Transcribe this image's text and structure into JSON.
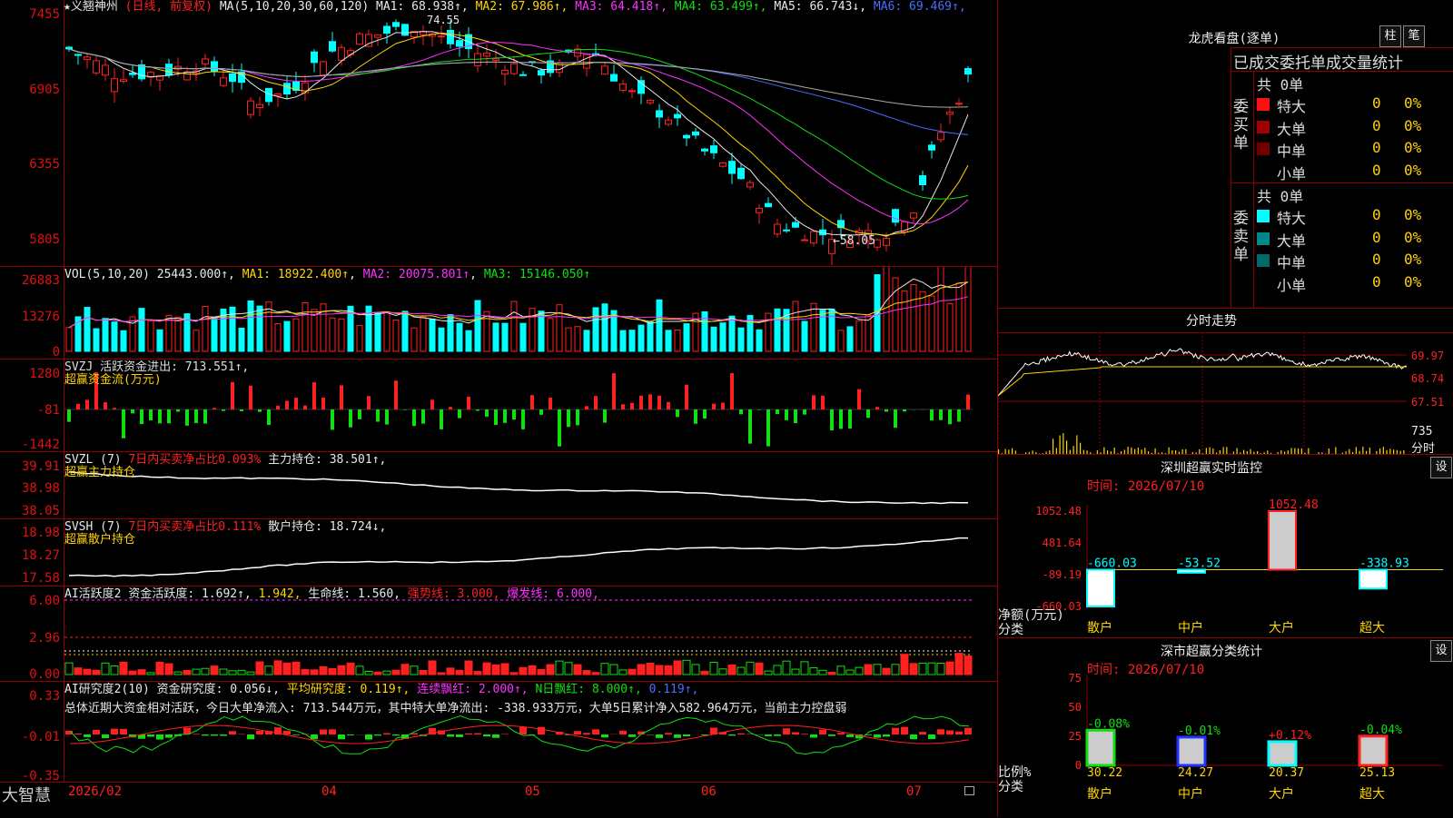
{
  "kline": {
    "stock_name": "义翘神州",
    "period_label": "(日线, 前复权)",
    "ma_params": "MA(5,10,20,30,60,120)",
    "ma_values": [
      {
        "label": "MA1: 68.938↑",
        "color": "#e8e8e8"
      },
      {
        "label": "MA2: 67.986↑",
        "color": "#ffd400"
      },
      {
        "label": "MA3: 64.418↑",
        "color": "#ff30ff"
      },
      {
        "label": "MA4: 63.499↑",
        "color": "#10e010"
      },
      {
        "label": "MA5: 66.743↓",
        "color": "#e8e8e8"
      },
      {
        "label": "MA6: 69.469↑",
        "color": "#4a6cff"
      }
    ],
    "high_mark": "74.55",
    "low_mark": "←58.05",
    "y_labels": [
      "7455",
      "6905",
      "6355",
      "5805"
    ]
  },
  "vol": {
    "header_name": "VOL(5,10,20)",
    "header_value": "25443.000↑",
    "ma1": "MA1: 18922.400↑",
    "ma2": "MA2: 20075.801↑",
    "ma3": "MA3: 15146.050↑",
    "y_labels": [
      "26883",
      "13276",
      "0"
    ]
  },
  "svzj": {
    "header": "SVZJ  活跃资金进出: 713.551↑,",
    "subtitle": "超赢资金流(万元)",
    "y_labels": [
      "1280",
      "-81",
      "-1442"
    ]
  },
  "svzl": {
    "header_name": "SVZL (7)",
    "header_ratio": "7日内买卖净占比0.093%",
    "header_hold": "主力持仓: 38.501↑,",
    "subtitle": "超赢主力持仓",
    "y_labels": [
      "39.91",
      "38.98",
      "38.05"
    ]
  },
  "svsh": {
    "header_name": "SVSH (7)",
    "header_ratio": "7日内买卖净占比0.111%",
    "header_hold": "散户持仓: 18.724↓,",
    "subtitle": "超赢散户持仓",
    "y_labels": [
      "18.98",
      "18.27",
      "17.58"
    ]
  },
  "ai_active": {
    "h1": "AI活跃度2",
    "h2": "资金活跃度: 1.692↑,",
    "h3": "1.942,",
    "h4": "生命线: 1.560,",
    "h5": "强势线: 3.000,",
    "h6": "爆发线: 6.000,",
    "y_labels": [
      "6.00",
      "2.96",
      "0.00"
    ]
  },
  "ai_research": {
    "h1": "AI研究度2(10)",
    "h2": "资金研究度: 0.056↓,",
    "h3": "平均研究度: 0.119↑,",
    "h4": "连续飘红: 2.000↑,",
    "h5": "N日飘红: 8.000↑,",
    "h6": "0.119↑,",
    "summary": "总体近期大资金相对活跃，今日大单净流入: 713.544万元，其中特大单净流出: -338.933万元，大单5日累计净入582.964万元，当前主力控盘弱",
    "y_labels": [
      "0.33",
      "-0.01",
      "-0.35"
    ]
  },
  "xaxis": {
    "brand": "大智慧",
    "dates": [
      "2026/02",
      "04",
      "05",
      "06",
      "07"
    ]
  },
  "dragon": {
    "title": "龙虎看盘(逐单)",
    "btn_bar": "柱",
    "btn_pen": "笔",
    "subtitle": "已成交委托单成交量统计",
    "buy_label": "委买单",
    "sell_label": "委卖单",
    "buy_total": "共 0单",
    "sell_total": "共 0单",
    "buy_rows": [
      {
        "label": "特大",
        "count": "0",
        "pct": "0%",
        "color": "#ff1010"
      },
      {
        "label": "大单",
        "count": "0",
        "pct": "0%",
        "color": "#a00000"
      },
      {
        "label": "中单",
        "count": "0",
        "pct": "0%",
        "color": "#700000"
      },
      {
        "label": "小单",
        "count": "0",
        "pct": "0%",
        "color": "#000000"
      }
    ],
    "sell_rows": [
      {
        "label": "特大",
        "count": "0",
        "pct": "0%",
        "color": "#00ffff"
      },
      {
        "label": "大单",
        "count": "0",
        "pct": "0%",
        "color": "#008888"
      },
      {
        "label": "中单",
        "count": "0",
        "pct": "0%",
        "color": "#006a6a"
      },
      {
        "label": "小单",
        "count": "0",
        "pct": "0%",
        "color": "#000000"
      }
    ]
  },
  "intraday": {
    "title": "分时走势",
    "y_labels": [
      "69.97",
      "68.74",
      "67.51"
    ],
    "vol_labels": [
      "735",
      "分时"
    ]
  },
  "sz_monitor": {
    "title": "深圳超赢实时监控",
    "btn": "设",
    "time": "时间: 2026/07/10",
    "y_labels": [
      "1052.48",
      "481.64",
      "-89.19",
      "-660.03"
    ],
    "bars": [
      {
        "cat": "散户",
        "value": -660.03,
        "label": "-660.03"
      },
      {
        "cat": "中户",
        "value": -53.52,
        "label": "-53.52"
      },
      {
        "cat": "大户",
        "value": 1052.48,
        "label": "1052.48"
      },
      {
        "cat": "超大",
        "value": -338.93,
        "label": "-338.93"
      }
    ],
    "net_label": "净额(万元)",
    "cat_label": "分类"
  },
  "sz_class": {
    "title": "深市超赢分类统计",
    "btn": "设",
    "time": "时间: 2026/07/10",
    "y_labels": [
      "75",
      "50",
      "25",
      "0"
    ],
    "bars": [
      {
        "cat": "散户",
        "value": 30.22,
        "label": "30.22",
        "chg": "-0.08%",
        "color": "#10e010"
      },
      {
        "cat": "中户",
        "value": 24.27,
        "label": "24.27",
        "chg": "-0.01%",
        "color": "#2233ff"
      },
      {
        "cat": "大户",
        "value": 20.37,
        "label": "20.37",
        "chg": "+0.12%",
        "color": "#00ffff"
      },
      {
        "cat": "超大",
        "value": 25.13,
        "label": "25.13",
        "chg": "-0.04%",
        "color": "#ff2020"
      }
    ],
    "ratio_label": "比例%",
    "cat_label": "分类"
  },
  "chart_data": {
    "type": "bar",
    "categories": [
      "散户",
      "中户",
      "大户",
      "超大"
    ],
    "series": [
      {
        "name": "净额(万元)",
        "values": [
          -660.03,
          -53.52,
          1052.48,
          -338.93
        ]
      },
      {
        "name": "比例%",
        "values": [
          30.22,
          24.27,
          20.37,
          25.13
        ]
      }
    ]
  }
}
